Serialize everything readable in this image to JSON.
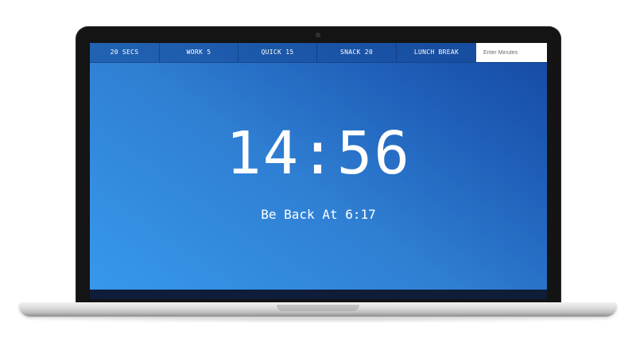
{
  "nav": {
    "items": [
      {
        "label": "20 SECS"
      },
      {
        "label": "WORK 5"
      },
      {
        "label": "QUICK 15"
      },
      {
        "label": "SNACK 20"
      },
      {
        "label": "LUNCH BREAK"
      }
    ],
    "minutes_input": {
      "placeholder": "Enter Minutes",
      "value": ""
    }
  },
  "timer": {
    "display": "14:56"
  },
  "status": {
    "back_at": "Be Back At 6:17"
  },
  "colors": {
    "gradient_light": "#3798ec",
    "gradient_dark": "#1549a2",
    "text": "#ffffff",
    "bezel": "#141414"
  }
}
